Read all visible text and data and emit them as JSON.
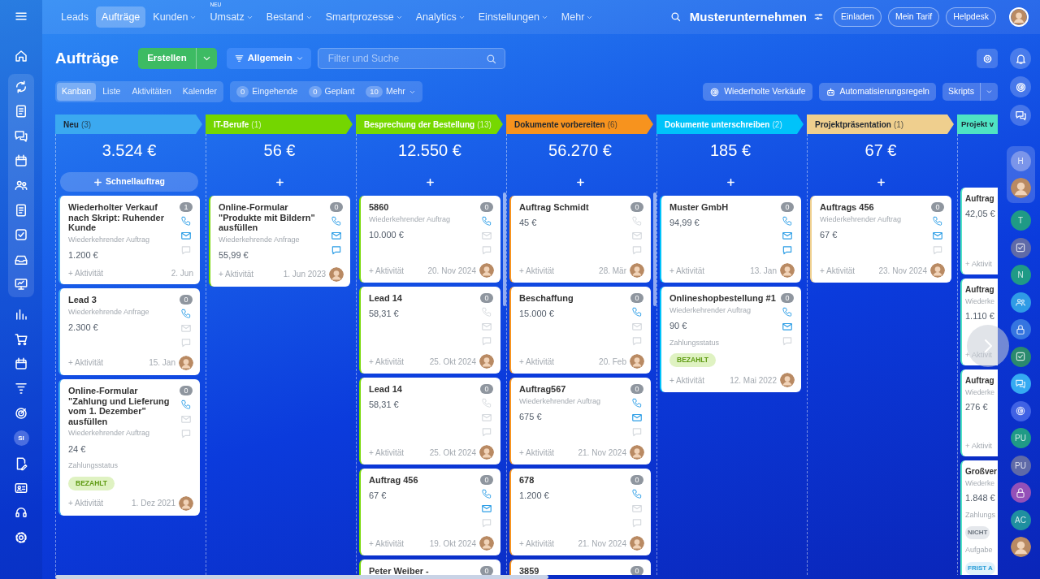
{
  "top_nav": {
    "items": [
      {
        "label": "Leads",
        "selected": false,
        "dropdown": false
      },
      {
        "label": "Aufträge",
        "selected": true,
        "dropdown": false
      },
      {
        "label": "Kunden",
        "selected": false,
        "dropdown": true
      },
      {
        "label": "Umsatz",
        "selected": false,
        "dropdown": true,
        "tag": "NEU"
      },
      {
        "label": "Bestand",
        "selected": false,
        "dropdown": true
      },
      {
        "label": "Smartprozesse",
        "selected": false,
        "dropdown": true
      },
      {
        "label": "Analytics",
        "selected": false,
        "dropdown": true
      },
      {
        "label": "Einstellungen",
        "selected": false,
        "dropdown": true
      },
      {
        "label": "Mehr",
        "selected": false,
        "dropdown": true
      }
    ],
    "company": "Musterunternehmen",
    "buttons": [
      "Einladen",
      "Mein Tarif",
      "Helpdesk"
    ]
  },
  "left_sidebar": {
    "avatar_initials": "SI"
  },
  "toolbar": {
    "title": "Aufträge",
    "create_button": "Erstellen",
    "filter_preset": "Allgemein",
    "search": {
      "placeholder": "Filter und Suche"
    }
  },
  "views": [
    {
      "label": "Kanban",
      "selected": true
    },
    {
      "label": "Liste",
      "selected": false
    },
    {
      "label": "Aktivitäten",
      "selected": false
    },
    {
      "label": "Kalender",
      "selected": false
    }
  ],
  "counters": [
    {
      "count": "0",
      "label": "Eingehende",
      "dropdown": false
    },
    {
      "count": "0",
      "label": "Geplant",
      "dropdown": false
    },
    {
      "count": "10",
      "label": "Mehr",
      "dropdown": true
    }
  ],
  "actions": [
    "Wiederholte Verkäufe",
    "Automatisierungsregeln"
  ],
  "scripts_button": "Skripts",
  "columns": [
    {
      "title": "Neu",
      "count": "(3)",
      "color": "#3ba9f0",
      "dark_label": true,
      "total": "3.524 €",
      "quick_add": "Schnellauftrag",
      "scrollbar": false,
      "cut": false,
      "cards": [
        {
          "title": "Wiederholter Verkauf nach Skript: Ruhender Kunde",
          "subtitle": "Wiederkehrender Auftrag",
          "amount": "1.200 €",
          "count": "1",
          "phone": true,
          "mail": true,
          "chat": false,
          "activity": "+ Aktivität",
          "date": "2. Jun",
          "avatar": false
        },
        {
          "title": "Lead 3",
          "subtitle": "Wiederkehrende Anfrage",
          "amount": "2.300 €",
          "count": "0",
          "phone": true,
          "mail": false,
          "chat": false,
          "activity": "+ Aktivität",
          "date": "15. Jan",
          "avatar": true
        },
        {
          "title": "Online-Formular \"Zahlung und Lieferung vom 1. Dezember\" ausfüllen",
          "subtitle": "Wiederkehrender Auftrag",
          "amount": "24 €",
          "fields": [
            {
              "label": "Zahlungsstatus",
              "badge": "BEZAHLT",
              "kind": "paid"
            }
          ],
          "count": "0",
          "phone": true,
          "mail": false,
          "chat": false,
          "activity": "+ Aktivität",
          "date": "1. Dez 2021",
          "avatar": true
        }
      ]
    },
    {
      "title": "IT-Berufe",
      "count": "(1)",
      "color": "#74d600",
      "dark_label": false,
      "total": "56 €",
      "scrollbar": false,
      "cut": false,
      "cards": [
        {
          "title": "Online-Formular \"Produkte mit Bildern\" ausfüllen",
          "subtitle": "Wiederkehrende Anfrage",
          "amount": "55,99 €",
          "count": "0",
          "phone": true,
          "mail": true,
          "chat": true,
          "activity": "+ Aktivität",
          "date": "1. Jun 2023",
          "avatar": true
        }
      ]
    },
    {
      "title": "Besprechung der Bestellung",
      "count": "(13)",
      "color": "#76d800",
      "dark_label": false,
      "total": "12.550 €",
      "scrollbar": true,
      "cut": false,
      "cards": [
        {
          "title": "5860",
          "subtitle": "Wiederkehrender Auftrag",
          "amount": "10.000 €",
          "count": "0",
          "phone": true,
          "mail": false,
          "chat": false,
          "activity": "+ Aktivität",
          "date": "20. Nov 2024",
          "avatar": true
        },
        {
          "title": "Lead 14",
          "amount": "58,31 €",
          "count": "0",
          "phone": false,
          "mail": false,
          "chat": false,
          "activity": "+ Aktivität",
          "date": "25. Okt 2024",
          "avatar": true
        },
        {
          "title": "Lead 14",
          "amount": "58,31 €",
          "count": "0",
          "phone": false,
          "mail": false,
          "chat": false,
          "activity": "+ Aktivität",
          "date": "25. Okt 2024",
          "avatar": true
        },
        {
          "title": "Auftrag 456",
          "amount": "67 €",
          "count": "0",
          "phone": true,
          "mail": true,
          "chat": false,
          "activity": "+ Aktivität",
          "date": "19. Okt 2024",
          "avatar": true
        },
        {
          "title": "Peter Weiber -",
          "count": "0"
        }
      ]
    },
    {
      "title": "Dokumente vorbereiten",
      "count": "(6)",
      "color": "#f7931e",
      "dark_label": true,
      "total": "56.270 €",
      "scrollbar": true,
      "cut": false,
      "cards": [
        {
          "title": "Auftrag Schmidt",
          "amount": "45 €",
          "count": "0",
          "phone": false,
          "mail": false,
          "chat": false,
          "activity": "+ Aktivität",
          "date": "28. Mär",
          "avatar": true
        },
        {
          "title": "Beschaffung",
          "amount": "15.000 €",
          "count": "0",
          "phone": true,
          "mail": false,
          "chat": false,
          "activity": "+ Aktivität",
          "date": "20. Feb",
          "avatar": true
        },
        {
          "title": "Auftrag567",
          "subtitle": "Wiederkehrender Auftrag",
          "amount": "675 €",
          "count": "0",
          "phone": true,
          "mail": true,
          "chat": false,
          "activity": "+ Aktivität",
          "date": "21. Nov 2024",
          "avatar": true
        },
        {
          "title": "678",
          "amount": "1.200 €",
          "count": "0",
          "phone": true,
          "mail": false,
          "chat": false,
          "activity": "+ Aktivität",
          "date": "21. Nov 2024",
          "avatar": true
        },
        {
          "title": "3859",
          "count": "0"
        }
      ]
    },
    {
      "title": "Dokumente unterschreiben",
      "count": "(2)",
      "color": "#00c3fa",
      "dark_label": false,
      "total": "185 €",
      "scrollbar": false,
      "cut": false,
      "cards": [
        {
          "title": "Muster GmbH",
          "amount": "94,99 €",
          "count": "0",
          "phone": true,
          "mail": true,
          "chat": true,
          "activity": "+ Aktivität",
          "date": "13. Jan",
          "avatar": true
        },
        {
          "title": "Onlineshopbestellung #1",
          "subtitle": "Wiederkehrender Auftrag",
          "amount": "90 €",
          "fields": [
            {
              "label": "Zahlungsstatus",
              "badge": "BEZAHLT",
              "kind": "paid"
            }
          ],
          "count": "0",
          "phone": true,
          "mail": true,
          "chat": false,
          "activity": "+ Aktivität",
          "date": "12. Mai 2022",
          "avatar": true
        }
      ]
    },
    {
      "title": "Projektpräsentation",
      "count": "(1)",
      "color": "#efcf8e",
      "dark_label": true,
      "total": "67 €",
      "scrollbar": false,
      "cut": false,
      "cards": [
        {
          "title": "Auftrags 456",
          "subtitle": "Wiederkehrender Auftrag",
          "amount": "67 €",
          "count": "0",
          "phone": true,
          "mail": true,
          "chat": false,
          "activity": "+ Aktivität",
          "date": "23. Nov 2024",
          "avatar": true
        }
      ]
    },
    {
      "title": "Projekt v",
      "color": "#4fe3c3",
      "dark_label": true,
      "scrollbar": false,
      "cut": true,
      "cards": [
        {
          "title": "Auftrag",
          "amount": "42,05 €",
          "activity": "+ Aktivit"
        },
        {
          "title": "Auftrag",
          "subtitle": "Wiederke",
          "amount": "1.110 €",
          "activity": "+ Aktivit"
        },
        {
          "title": "Auftrag",
          "subtitle": "Wiederke",
          "amount": "276 €",
          "activity": "+ Aktivit"
        },
        {
          "title": "Großver",
          "subtitle": "Wiederke",
          "amount": "1.848 €",
          "fields": [
            {
              "label": "Zahlungs",
              "badge": "NICHT",
              "kind": "unpaid"
            },
            {
              "label": "Aufgabe",
              "badge": "FRIST A",
              "kind": "deadline"
            }
          ]
        }
      ]
    }
  ],
  "right_sidebar": {
    "pinned": [
      {
        "kind": "initials",
        "initials": "H",
        "color": "#7b95ea"
      },
      {
        "kind": "photo"
      }
    ],
    "items": [
      {
        "kind": "initials",
        "initials": "T",
        "color": "#1f9a86"
      },
      {
        "kind": "icon",
        "color": "#5f6aa8"
      },
      {
        "kind": "initials",
        "initials": "N",
        "color": "#1f9a86"
      },
      {
        "kind": "icon",
        "color": "#2f9be6"
      },
      {
        "kind": "icon",
        "color": "#3575e0"
      },
      {
        "kind": "icon",
        "color": "#2a8a6e"
      },
      {
        "kind": "icon",
        "color": "#35aaf2"
      },
      {
        "kind": "icon",
        "color": "#4062e4"
      },
      {
        "kind": "initials",
        "initials": "PU",
        "color": "#1f9a86"
      },
      {
        "kind": "initials",
        "initials": "PU",
        "color": "#5f6aa8"
      },
      {
        "kind": "icon",
        "color": "#9450b8"
      },
      {
        "kind": "initials",
        "initials": "AC",
        "color": "#1f8fa0"
      },
      {
        "kind": "photo"
      }
    ]
  }
}
